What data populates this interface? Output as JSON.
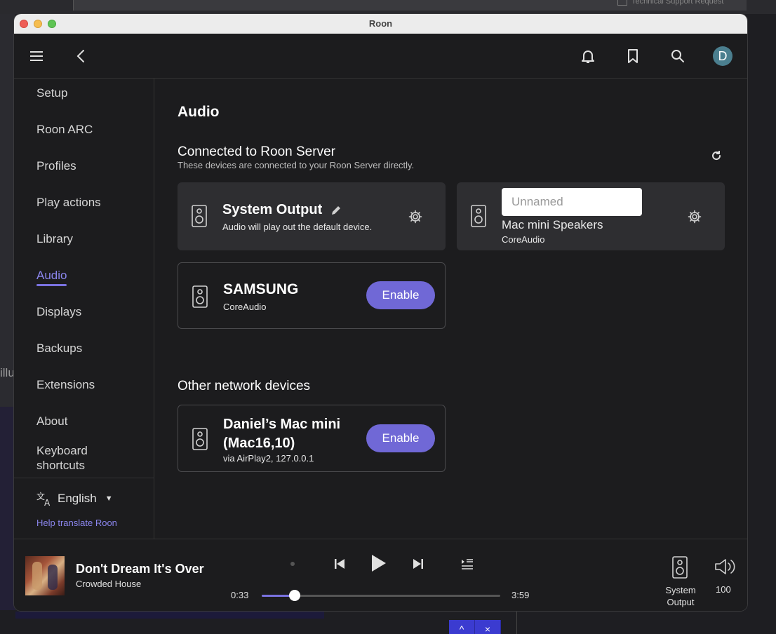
{
  "background": {
    "top_right_text": "Technical Support Request",
    "left_text": "illu",
    "button_up": "^",
    "button_down": "×"
  },
  "window": {
    "title": "Roon"
  },
  "topbar": {
    "avatar_letter": "D"
  },
  "sidebar": {
    "items": [
      {
        "label": "Setup"
      },
      {
        "label": "Roon ARC"
      },
      {
        "label": "Profiles"
      },
      {
        "label": "Play actions"
      },
      {
        "label": "Library"
      },
      {
        "label": "Audio"
      },
      {
        "label": "Displays"
      },
      {
        "label": "Backups"
      },
      {
        "label": "Extensions"
      },
      {
        "label": "About"
      },
      {
        "label": "Keyboard shortcuts"
      }
    ],
    "active_index": 5,
    "language": "English",
    "help_link": "Help translate Roon"
  },
  "main": {
    "title": "Audio",
    "connected": {
      "heading": "Connected to Roon Server",
      "subtitle": "These devices are connected to your Roon Server directly."
    },
    "devices": [
      {
        "name": "System Output",
        "description": "Audio will play out the default device."
      },
      {
        "name": "Mac mini Speakers",
        "description": "CoreAudio",
        "name_placeholder": "Unnamed"
      },
      {
        "name": "SAMSUNG",
        "description": "CoreAudio",
        "button": "Enable"
      }
    ],
    "other": {
      "heading": "Other network devices",
      "devices": [
        {
          "name": "Daniel’s Mac mini (Mac16,10)",
          "description": "via AirPlay2, 127.0.0.1",
          "button": "Enable"
        }
      ]
    }
  },
  "player": {
    "track_title": "Don't Dream It's Over",
    "artist": "Crowded House",
    "elapsed": "0:33",
    "duration": "3:59",
    "progress_fraction": 0.138,
    "zone": "System Output",
    "volume": "100"
  },
  "colors": {
    "accent": "#7068d6",
    "background": "#1c1c1e",
    "card": "#2e2e31"
  }
}
